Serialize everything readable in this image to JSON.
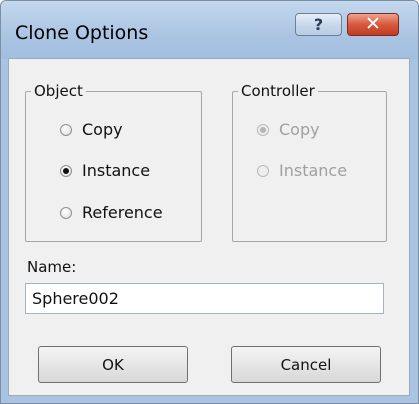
{
  "window": {
    "title": "Clone Options",
    "help_icon": "question-mark-icon",
    "help_glyph": "?",
    "close_icon": "close-x-icon",
    "close_glyph": "✕"
  },
  "object_group": {
    "label": "Object",
    "options": [
      {
        "label": "Copy",
        "checked": false,
        "enabled": true
      },
      {
        "label": "Instance",
        "checked": true,
        "enabled": true
      },
      {
        "label": "Reference",
        "checked": false,
        "enabled": true
      }
    ]
  },
  "controller_group": {
    "label": "Controller",
    "options": [
      {
        "label": "Copy",
        "checked": true,
        "enabled": false
      },
      {
        "label": "Instance",
        "checked": false,
        "enabled": false
      }
    ]
  },
  "name_field": {
    "label": "Name:",
    "value": "Sphere002"
  },
  "buttons": {
    "ok_label": "OK",
    "cancel_label": "Cancel"
  }
}
